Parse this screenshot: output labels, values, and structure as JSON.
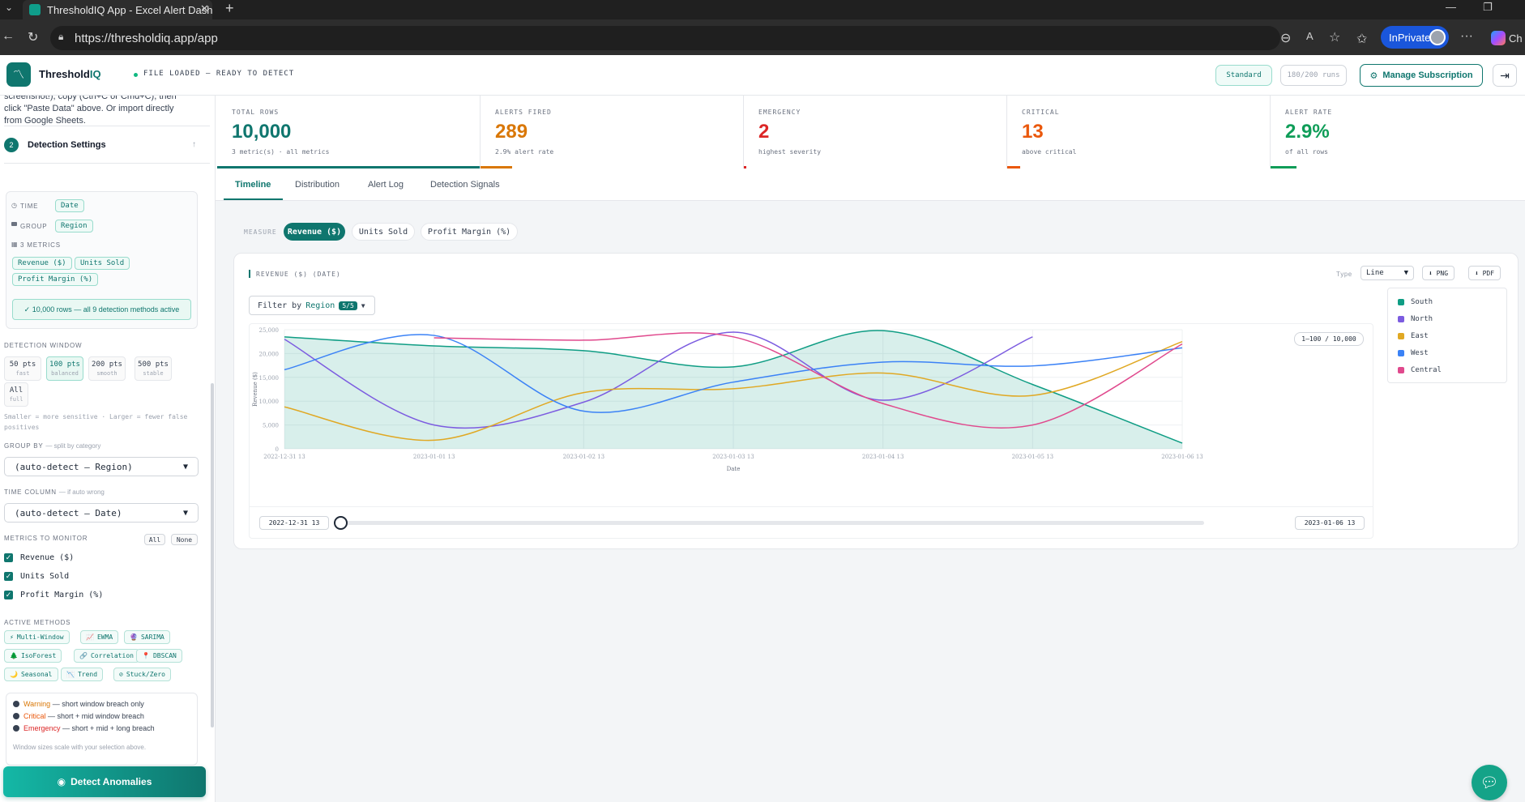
{
  "browser": {
    "tab_title": "ThresholdIQ App - Excel Alert Dash",
    "url": "https://thresholdiq.app/app",
    "inprivate_label": "InPrivate",
    "edge_label": "Ch"
  },
  "header": {
    "brand_prefix": "Threshold",
    "brand_suffix": "IQ",
    "status_text": "FILE LOADED — READY TO DETECT",
    "plan_label": "Standard",
    "runs_label": "180/200 runs",
    "manage_label": "Manage Subscription"
  },
  "sidebar": {
    "intro_text": "screenshot!), copy (Ctrl+C or Cmd+C), then click \"Paste Data\" above. Or import directly from Google Sheets.",
    "step_number": "2",
    "step_title": "Detection Settings",
    "config": {
      "time_label": "TIME",
      "time_value": "Date",
      "group_label": "GROUP",
      "group_value": "Region",
      "metrics_label": "3 METRICS",
      "metrics": [
        "Revenue ($)",
        "Units Sold",
        "Profit Margin (%)"
      ],
      "ready_text": "✓ 10,000 rows — all 9 detection methods active"
    },
    "window_label": "DETECTION WINDOW",
    "windows": [
      {
        "value": "50 pts",
        "sub": "fast"
      },
      {
        "value": "100 pts",
        "sub": "balanced"
      },
      {
        "value": "200 pts",
        "sub": "smooth"
      },
      {
        "value": "500 pts",
        "sub": "stable"
      },
      {
        "value": "All",
        "sub": "full"
      }
    ],
    "window_hint": "Smaller = more sensitive · Larger = fewer false positives",
    "group_by_label": "GROUP BY",
    "group_by_hint": "— split by category",
    "group_by_value": "(auto-detect — Region)",
    "time_col_label": "TIME COLUMN",
    "time_col_hint": "— if auto wrong",
    "time_col_value": "(auto-detect — Date)",
    "monitor_label": "METRICS TO MONITOR",
    "all_label": "All",
    "none_label": "None",
    "monitor_items": [
      "Revenue ($)",
      "Units Sold",
      "Profit Margin (%)"
    ],
    "methods_label": "ACTIVE METHODS",
    "methods": [
      {
        "icon": "⚡",
        "label": "Multi-Window"
      },
      {
        "icon": "📈",
        "label": "EWMA"
      },
      {
        "icon": "🔮",
        "label": "SARIMA"
      },
      {
        "icon": "🌲",
        "label": "IsoForest"
      },
      {
        "icon": "🔗",
        "label": "Correlation"
      },
      {
        "icon": "📍",
        "label": "DBSCAN"
      },
      {
        "icon": "🌙",
        "label": "Seasonal"
      },
      {
        "icon": "📉",
        "label": "Trend"
      },
      {
        "icon": "⊘",
        "label": "Stuck/Zero"
      }
    ],
    "severity": [
      {
        "name": "Warning",
        "desc": " — short window breach only",
        "color": "#d97706"
      },
      {
        "name": "Critical",
        "desc": " — short + mid window breach",
        "color": "#ea580c"
      },
      {
        "name": "Emergency",
        "desc": " — short + mid + long breach",
        "color": "#dc2626"
      }
    ],
    "scale_note": "Window sizes scale with your selection above.",
    "detect_label": "Detect Anomalies"
  },
  "stats": [
    {
      "label": "TOTAL ROWS",
      "value": "10,000",
      "sub": "3 metric(s) · all metrics",
      "color": "#0f766e",
      "fill": 1.0
    },
    {
      "label": "ALERTS FIRED",
      "value": "289",
      "sub": "2.9% alert rate",
      "color": "#d97706",
      "fill": 0.12
    },
    {
      "label": "EMERGENCY",
      "value": "2",
      "sub": "highest severity",
      "color": "#dc2626",
      "fill": 0.01
    },
    {
      "label": "CRITICAL",
      "value": "13",
      "sub": "above critical",
      "color": "#ea580c",
      "fill": 0.05
    },
    {
      "label": "ALERT RATE",
      "value": "2.9%",
      "sub": "of all rows",
      "color": "#0f9d58",
      "fill": 0.1
    }
  ],
  "tabs": [
    "Timeline",
    "Distribution",
    "Alert Log",
    "Detection Signals"
  ],
  "measure": {
    "label": "MEASURE",
    "options": [
      "Revenue ($)",
      "Units Sold",
      "Profit Margin (%)"
    ]
  },
  "chart_panel": {
    "heading": "REVENUE ($) (DATE)",
    "type_label": "Type",
    "type_value": "Line",
    "png_label": "⬇ PNG",
    "pdf_label": "⬇ PDF",
    "filter_prefix": "Filter by",
    "filter_field": "Region",
    "filter_count": "5/5",
    "range_label": "1–100 / 10,000",
    "slider_start": "2022-12-31 13",
    "slider_end": "2023-01-06 13",
    "slider_position": 0.0
  },
  "chart_data": {
    "type": "line",
    "xlabel": "Date",
    "ylabel": "Revenue ($)",
    "ylim": [
      0,
      25000
    ],
    "yticks": [
      0,
      5000,
      10000,
      15000,
      20000,
      25000
    ],
    "ytick_labels": [
      "0",
      "5,000",
      "10,000",
      "15,000",
      "20,000",
      "25,000"
    ],
    "x": [
      "2022-12-31 13",
      "2023-01-01 13",
      "2023-01-02 13",
      "2023-01-03 13",
      "2023-01-04 13",
      "2023-01-05 13",
      "2023-01-06 13"
    ],
    "legend_position": "right",
    "series": [
      {
        "name": "South",
        "color": "#0f9d84",
        "area": true,
        "values": [
          23500,
          21600,
          20600,
          17200,
          24800,
          13500,
          1200
        ]
      },
      {
        "name": "North",
        "color": "#7c5ce0",
        "values": [
          23000,
          5000,
          9800,
          24500,
          10200,
          23500,
          null
        ]
      },
      {
        "name": "East",
        "color": "#e0a823",
        "values": [
          8800,
          1800,
          11800,
          12600,
          15900,
          11200,
          22500
        ]
      },
      {
        "name": "West",
        "color": "#3b82f6",
        "values": [
          16600,
          23800,
          7900,
          14000,
          18200,
          17400,
          21200
        ]
      },
      {
        "name": "Central",
        "color": "#e0498d",
        "values": [
          null,
          23300,
          22800,
          23500,
          9500,
          5000,
          22000
        ]
      }
    ]
  }
}
